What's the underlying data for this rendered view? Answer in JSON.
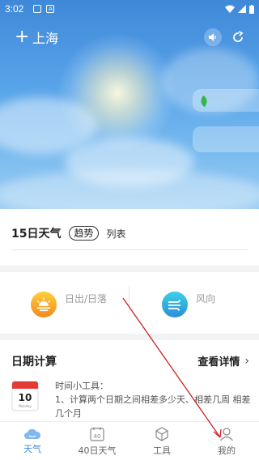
{
  "status_bar": {
    "time": "3:02"
  },
  "header": {
    "add_icon": "plus-icon",
    "city": "上海",
    "sound_icon": "speaker-icon",
    "share_icon": "share-icon"
  },
  "forecast": {
    "title": "15日天气",
    "tab_trend": "趋势",
    "tab_list": "列表"
  },
  "sun_wind": {
    "sunrise_label": "日出/日落",
    "wind_label": "风向"
  },
  "date_calc": {
    "title": "日期计算",
    "more_label": "查看详情",
    "calendar_day": "10",
    "calendar_sub": "Monday",
    "line1": "时间小工具：",
    "line2": "1、计算两个日期之间相差多少天、相差几周 相差几个月"
  },
  "tabbar": {
    "items": [
      {
        "label": "天气",
        "icon": "cloud-icon",
        "active": true
      },
      {
        "label": "40日天气",
        "icon": "calendar-40-icon",
        "active": false
      },
      {
        "label": "工具",
        "icon": "box-icon",
        "active": false
      },
      {
        "label": "我的",
        "icon": "user-icon",
        "active": false
      }
    ],
    "calendar_40_text": "40"
  },
  "colors": {
    "accent": "#3a8ee6",
    "sky_top": "#3f88d8",
    "sun_orange": "#f08a20",
    "wind_teal": "#2b8fd8",
    "annotation_arrow": "#d02020"
  }
}
